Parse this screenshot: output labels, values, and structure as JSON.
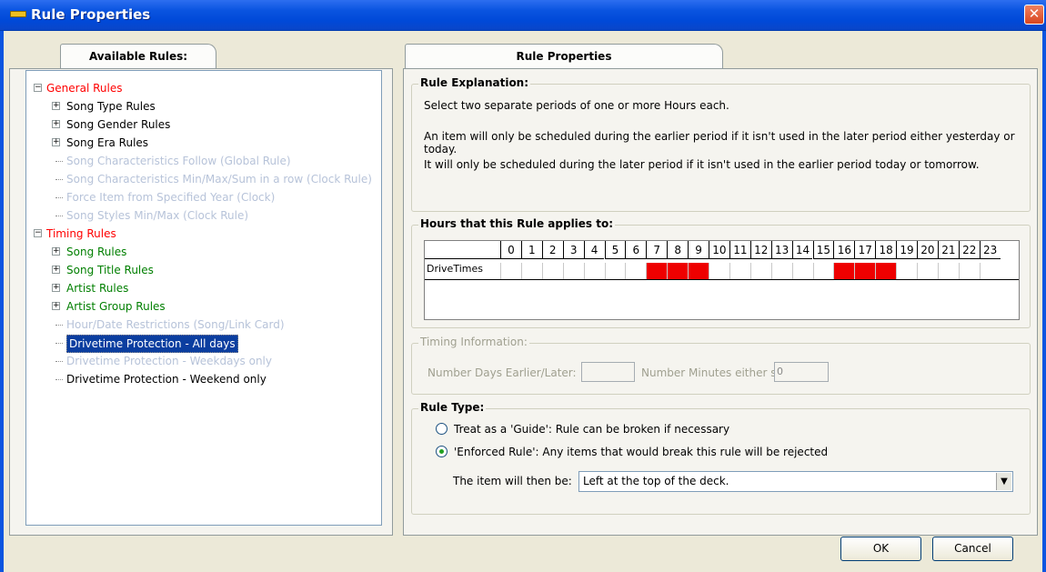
{
  "window": {
    "title": "Rule Properties",
    "close_glyph": "✕"
  },
  "left_tab": {
    "label": "Available Rules:"
  },
  "right_tab": {
    "label": "Rule Properties"
  },
  "tree": [
    {
      "label": "General Rules",
      "color": "red",
      "expander": "−",
      "depth": 0
    },
    {
      "label": "Song Type Rules",
      "color": "black",
      "expander": "+",
      "depth": 1
    },
    {
      "label": "Song Gender Rules",
      "color": "black",
      "expander": "+",
      "depth": 1
    },
    {
      "label": "Song Era Rules",
      "color": "black",
      "expander": "+",
      "depth": 1
    },
    {
      "label": "Song Characteristics Follow (Global Rule)",
      "color": "gray",
      "expander": "",
      "depth": 1
    },
    {
      "label": "Song Characteristics Min/Max/Sum in a row (Clock Rule)",
      "color": "gray",
      "expander": "",
      "depth": 1
    },
    {
      "label": "Force Item from Specified Year (Clock)",
      "color": "gray",
      "expander": "",
      "depth": 1
    },
    {
      "label": "Song Styles Min/Max (Clock Rule)",
      "color": "gray",
      "expander": "",
      "depth": 1
    },
    {
      "label": "Timing Rules",
      "color": "red",
      "expander": "−",
      "depth": 0
    },
    {
      "label": "Song Rules",
      "color": "green",
      "expander": "+",
      "depth": 1
    },
    {
      "label": "Song Title Rules",
      "color": "green",
      "expander": "+",
      "depth": 1
    },
    {
      "label": "Artist Rules",
      "color": "green",
      "expander": "+",
      "depth": 1
    },
    {
      "label": "Artist Group Rules",
      "color": "green",
      "expander": "+",
      "depth": 1
    },
    {
      "label": "Hour/Date Restrictions (Song/Link Card)",
      "color": "gray",
      "expander": "",
      "depth": 1
    },
    {
      "label": "Drivetime Protection - All days",
      "color": "selected",
      "expander": "",
      "depth": 1
    },
    {
      "label": "Drivetime Protection - Weekdays only",
      "color": "gray",
      "expander": "",
      "depth": 1
    },
    {
      "label": "Drivetime Protection - Weekend only",
      "color": "black",
      "expander": "",
      "depth": 1
    }
  ],
  "explanation": {
    "legend": "Rule Explanation:",
    "line1": "Select two separate periods of one or more Hours each.",
    "line2": "An item will only be scheduled during the earlier period if it isn't used in the later period either yesterday or",
    "line3": "today.",
    "line4": "It will only be scheduled during the later period if it isn't used in the earlier period today or tomorrow."
  },
  "hours": {
    "legend": "Hours that this Rule applies to:",
    "row_label": "DriveTimes",
    "columns": [
      "0",
      "1",
      "2",
      "3",
      "4",
      "5",
      "6",
      "7",
      "8",
      "9",
      "10",
      "11",
      "12",
      "13",
      "14",
      "15",
      "16",
      "17",
      "18",
      "19",
      "20",
      "21",
      "22",
      "23"
    ],
    "active": [
      7,
      8,
      9,
      16,
      17,
      18
    ]
  },
  "timing": {
    "legend": "Timing Information:",
    "days_label": "Number Days Earlier/Later:",
    "days_value": "",
    "minutes_label": "Number Minutes either si",
    "minutes_value": "0"
  },
  "rule_type": {
    "legend": "Rule Type:",
    "option_guide": "Treat as a 'Guide': Rule can be broken if necessary",
    "option_enforced": "'Enforced Rule': Any items that would break this rule will be rejected",
    "selected": "enforced",
    "then_label": "The item will then be:",
    "then_value": "Left at the top of the deck."
  },
  "buttons": {
    "ok": "OK",
    "cancel": "Cancel"
  }
}
